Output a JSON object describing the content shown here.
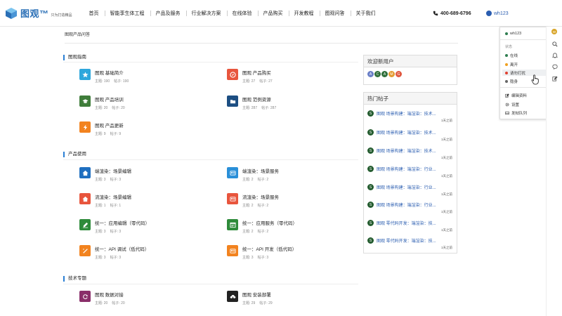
{
  "header": {
    "logo_text": "图观™",
    "logo_sub": "只为打造精品",
    "nav": [
      "首页",
      "智能孪生体工程",
      "产品及服务",
      "行业解决方案",
      "在线体验",
      "产品购买",
      "开发教程",
      "图观问答",
      "关于我们"
    ],
    "phone": "400-689-6796",
    "username": "wh123"
  },
  "breadcrumb": "图观产品问答",
  "sections": [
    {
      "title": "图观指南",
      "cards": [
        {
          "title": "图观 基础简介",
          "topics_label": "主题: 190",
          "posts_label": "帖子: 190",
          "icon": "star-icon",
          "color": "#2ea7dc"
        },
        {
          "title": "图观 产品购买",
          "topics_label": "主题: 27",
          "posts_label": "帖子: 27",
          "icon": "compass-icon",
          "color": "#e8553d"
        },
        {
          "title": "图观 产品培训",
          "topics_label": "主题: 20",
          "posts_label": "帖子: 20",
          "icon": "graduation-cap-icon",
          "color": "#3f7d3a"
        },
        {
          "title": "图观 范例资源",
          "topics_label": "主题: 287",
          "posts_label": "帖子: 287",
          "icon": "folder-icon",
          "color": "#1c4e82"
        },
        {
          "title": "图观 产品更新",
          "topics_label": "主题: 9",
          "posts_label": "帖子: 9",
          "icon": "bolt-icon",
          "color": "#f2831f"
        }
      ]
    },
    {
      "title": "产品使用",
      "cards": [
        {
          "title": "端渲染：场景编辑",
          "topics_label": "主题: 3",
          "posts_label": "帖子: 3",
          "icon": "home-icon",
          "color": "#1f6fc0"
        },
        {
          "title": "端渲染：场景服务",
          "topics_label": "主题: 2",
          "posts_label": "帖子: 2",
          "icon": "id-card-icon",
          "color": "#2a8fd8"
        },
        {
          "title": "流渲染：场景编辑",
          "topics_label": "主题: 1",
          "posts_label": "帖子: 1",
          "icon": "home-icon",
          "color": "#e8553d"
        },
        {
          "title": "流渲染：场景服务",
          "topics_label": "主题: 2",
          "posts_label": "帖子: 2",
          "icon": "id-card-icon",
          "color": "#e8553d"
        },
        {
          "title": "统一：应用编辑（零代码）",
          "topics_label": "主题: 3",
          "posts_label": "帖子: 3",
          "icon": "edit-icon",
          "color": "#2e8b3a"
        },
        {
          "title": "统一：应用服务（零代码）",
          "topics_label": "主题: 2",
          "posts_label": "帖子: 2",
          "icon": "window-edit-icon",
          "color": "#2e8b3a"
        },
        {
          "title": "统一：API 调试（低代码）",
          "topics_label": "主题: 3",
          "posts_label": "帖子: 3",
          "icon": "wand-icon",
          "color": "#f2831f"
        },
        {
          "title": "统一：API 开发（低代码）",
          "topics_label": "主题: 3",
          "posts_label": "帖子: 3",
          "icon": "id-card-icon",
          "color": "#f2831f"
        }
      ]
    },
    {
      "title": "技术专题",
      "cards": [
        {
          "title": "图观 数据对接",
          "topics_label": "主题: 20",
          "posts_label": "帖子: 20",
          "icon": "refresh-icon",
          "color": "#8a2e6a"
        },
        {
          "title": "图观 安装部署",
          "topics_label": "主题: 29",
          "posts_label": "帖子: 29",
          "icon": "cloud-download-icon",
          "color": "#222222"
        }
      ]
    }
  ],
  "welcome": {
    "title": "欢迎新用户",
    "avatars": [
      {
        "letter": "A",
        "color": "#6a7fc7"
      },
      {
        "letter": "C",
        "color": "#2f6f3a"
      },
      {
        "letter": "A",
        "color": "#2f6f3a"
      },
      {
        "letter": "M",
        "color": "#e39a2f"
      },
      {
        "letter": "G",
        "color": "#e0573f"
      }
    ]
  },
  "hot": {
    "title": "热门帖子",
    "posts": [
      {
        "avatar": "S",
        "title": "图观 场景构建：端渲染：技术...",
        "time": "1天之前"
      },
      {
        "avatar": "S",
        "title": "图观 场景构建：端渲染：技术...",
        "time": "1天之前"
      },
      {
        "avatar": "S",
        "title": "图观 场景构建：端渲染：技术...",
        "time": "1天之前"
      },
      {
        "avatar": "S",
        "title": "图观 场景构建：端渲染：行业...",
        "time": "1天之前"
      },
      {
        "avatar": "S",
        "title": "图观 场景构建：端渲染：行业...",
        "time": "1天之前"
      },
      {
        "avatar": "S",
        "title": "图观 场景构建：端渲染：行业...",
        "time": "1天之前"
      },
      {
        "avatar": "S",
        "title": "图观 零代码开发：端渲染：技...",
        "time": "1天之前"
      },
      {
        "avatar": "S",
        "title": "图观 零代码开发：端渲染：技...",
        "time": "1天之前"
      }
    ]
  },
  "dropdown": {
    "username": "wh123",
    "status_label": "状态",
    "statuses": [
      {
        "label": "在线",
        "color": "#2e7d4f"
      },
      {
        "label": "离开",
        "color": "#f0a020"
      },
      {
        "label": "请勿打扰",
        "color": "#e04030"
      },
      {
        "label": "隐身",
        "color": "#666666"
      }
    ],
    "actions": [
      "编辑资料",
      "设置",
      "发帖队列"
    ]
  },
  "sidebar_avatar": "W"
}
